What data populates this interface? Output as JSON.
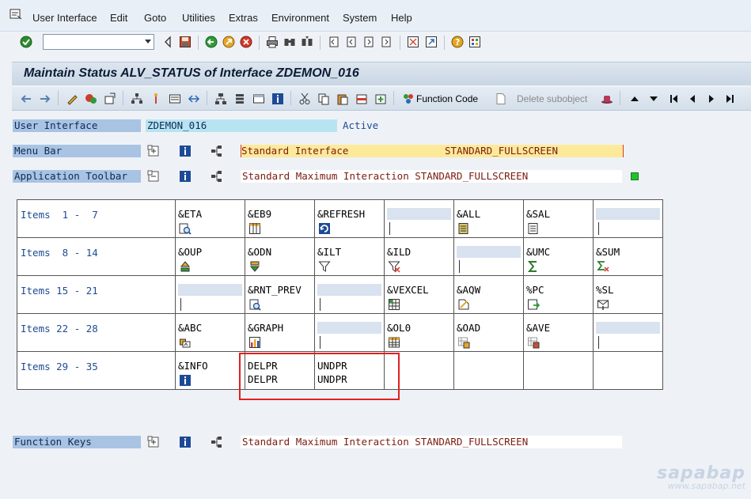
{
  "menu": [
    "User Interface",
    "Edit",
    "Goto",
    "Utilities",
    "Extras",
    "Environment",
    "System",
    "Help"
  ],
  "title": "Maintain Status ALV_STATUS of Interface ZDEMON_016",
  "app_toolbar": {
    "function_code": "Function Code",
    "delete_subobject": "Delete subobject"
  },
  "form": {
    "user_interface": {
      "label": "User Interface",
      "value": "ZDEMON_016",
      "status": "Active"
    },
    "menu_bar": {
      "label": "Menu Bar",
      "value": "Standard Interface",
      "value2": "STANDARD_FULLSCREEN"
    },
    "app_toolbar": {
      "label": "Application Toolbar",
      "value": "Standard Maximum Interaction STANDARD_FULLSCREEN"
    },
    "function_keys": {
      "label": "Function Keys",
      "value": "Standard Maximum Interaction STANDARD_FULLSCREEN"
    }
  },
  "grid": {
    "rows": [
      {
        "label": "Items  1 -  7",
        "cells": [
          {
            "code": "&ETA",
            "icon": "magnifier-list-icon"
          },
          {
            "code": "&EB9",
            "icon": "table-layout-icon"
          },
          {
            "code": "&REFRESH",
            "icon": "refresh-icon"
          },
          {
            "code": "",
            "icon": ""
          },
          {
            "code": "&ALL",
            "icon": "select-all-icon"
          },
          {
            "code": "&SAL",
            "icon": "deselect-all-icon"
          },
          {
            "code": "",
            "icon": ""
          }
        ]
      },
      {
        "label": "Items  8 - 14",
        "cells": [
          {
            "code": "&OUP",
            "icon": "sort-up-icon"
          },
          {
            "code": "&ODN",
            "icon": "sort-down-icon"
          },
          {
            "code": "&ILT",
            "icon": "filter-icon"
          },
          {
            "code": "&ILD",
            "icon": "filter-delete-icon"
          },
          {
            "code": "",
            "icon": ""
          },
          {
            "code": "&UMC",
            "icon": "sigma-icon"
          },
          {
            "code": "&SUM",
            "icon": "subtotal-icon"
          }
        ]
      },
      {
        "label": "Items 15 - 21",
        "cells": [
          {
            "code": "",
            "icon": ""
          },
          {
            "code": "&RNT_PREV",
            "icon": "print-preview-icon"
          },
          {
            "code": "",
            "icon": ""
          },
          {
            "code": "&VEXCEL",
            "icon": "excel-icon"
          },
          {
            "code": "&AQW",
            "icon": "word-processing-icon"
          },
          {
            "code": "%PC",
            "icon": "local-file-icon"
          },
          {
            "code": "%SL",
            "icon": "mail-recipient-icon"
          }
        ]
      },
      {
        "label": "Items 22 - 28",
        "cells": [
          {
            "code": "&ABC",
            "icon": "abc-analysis-icon"
          },
          {
            "code": "&GRAPH",
            "icon": "graphic-icon"
          },
          {
            "code": "",
            "icon": ""
          },
          {
            "code": "&OL0",
            "icon": "change-layout-icon"
          },
          {
            "code": "&OAD",
            "icon": "select-layout-icon"
          },
          {
            "code": "&AVE",
            "icon": "save-layout-icon"
          },
          {
            "code": "",
            "icon": ""
          }
        ]
      },
      {
        "label": "Items 29 - 35",
        "cells": [
          {
            "code": "&INFO",
            "icon": "info-icon",
            "line2": ""
          },
          {
            "code": "DELPR",
            "icon": "",
            "line2": "DELPR"
          },
          {
            "code": "UNDPR",
            "icon": "",
            "line2": "UNDPR"
          },
          {
            "code": "",
            "icon": "",
            "blank": true
          },
          {
            "code": "",
            "icon": "",
            "blank": true
          },
          {
            "code": "",
            "icon": "",
            "blank": true
          },
          {
            "code": "",
            "icon": "",
            "blank": true
          }
        ]
      }
    ]
  },
  "watermark": {
    "brand": "sapabap",
    "url": "www.sapabap.net"
  },
  "colors": {
    "title_bg": "#c9d6e4",
    "label_bg": "#a9c3e3",
    "active_bg": "#b8e4f2",
    "menubar_value_bg": "#fde99a",
    "status_green": "#22c22e",
    "highlight_red": "#e02020"
  }
}
